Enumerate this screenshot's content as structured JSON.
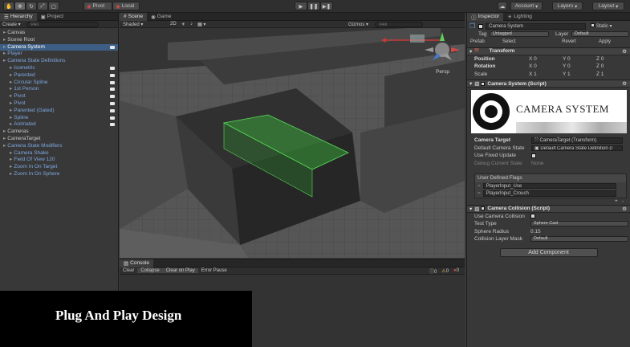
{
  "toolbar": {
    "pivot": "Pivot",
    "local": "Local",
    "account": "Account",
    "layers": "Layers",
    "layout": "Layout"
  },
  "hierarchy": {
    "tab_hierarchy": "Hierarchy",
    "tab_project": "Project",
    "create": "Create",
    "search_placeholder": "All",
    "items": [
      {
        "label": "Canvas",
        "indent": 0,
        "style": "normal",
        "cam": false
      },
      {
        "label": "Scene Root",
        "indent": 0,
        "style": "normal",
        "cam": false
      },
      {
        "label": "Camera System",
        "indent": 0,
        "style": "selected",
        "cam": true
      },
      {
        "label": "Player",
        "indent": 0,
        "style": "blue",
        "cam": false
      },
      {
        "label": "Camera State Definitions",
        "indent": 0,
        "style": "blue",
        "cam": false
      },
      {
        "label": "Isometric",
        "indent": 1,
        "style": "blue",
        "cam": true
      },
      {
        "label": "Parented",
        "indent": 1,
        "style": "blue",
        "cam": true
      },
      {
        "label": "Circular Spline",
        "indent": 1,
        "style": "blue",
        "cam": true
      },
      {
        "label": "1st Person",
        "indent": 1,
        "style": "blue",
        "cam": true
      },
      {
        "label": "Pivot",
        "indent": 1,
        "style": "blue",
        "cam": true
      },
      {
        "label": "Pivot",
        "indent": 1,
        "style": "blue",
        "cam": true
      },
      {
        "label": "Parented (Gated)",
        "indent": 1,
        "style": "blue",
        "cam": true
      },
      {
        "label": "Spline",
        "indent": 1,
        "style": "blue",
        "cam": true
      },
      {
        "label": "Animated",
        "indent": 1,
        "style": "blue",
        "cam": true
      },
      {
        "label": "Cameras",
        "indent": 0,
        "style": "normal",
        "cam": false
      },
      {
        "label": "CameraTarget",
        "indent": 0,
        "style": "normal",
        "cam": false
      },
      {
        "label": "Camera State Modifiers",
        "indent": 0,
        "style": "blue",
        "cam": false
      },
      {
        "label": "Camera Shake",
        "indent": 1,
        "style": "blue",
        "cam": false
      },
      {
        "label": "Field Of View 120",
        "indent": 1,
        "style": "blue",
        "cam": false
      },
      {
        "label": "Zoom In On Target",
        "indent": 1,
        "style": "blue",
        "cam": false
      },
      {
        "label": "Zoom In On Sphere",
        "indent": 1,
        "style": "blue",
        "cam": false
      }
    ]
  },
  "scene": {
    "tab_scene": "Scene",
    "tab_game": "Game",
    "shaded": "Shaded",
    "mode_2d": "2D",
    "gizmos": "Gizmos",
    "search_placeholder": "All",
    "persp": "Persp"
  },
  "console": {
    "tab": "Console",
    "clear": "Clear",
    "collapse": "Collapse",
    "clear_on_play": "Clear on Play",
    "error_pause": "Error Pause",
    "count_info": "0",
    "count_warn": "0",
    "count_error": "0"
  },
  "inspector": {
    "tab_inspector": "Inspector",
    "tab_lighting": "Lighting",
    "object_name": "Camera System",
    "static_label": "Static",
    "tag_label": "Tag",
    "tag_value": "Untagged",
    "layer_label": "Layer",
    "layer_value": "Default",
    "prefab_label": "Prefab",
    "prefab_select": "Select",
    "prefab_revert": "Revert",
    "prefab_apply": "Apply",
    "transform": {
      "title": "Transform",
      "position_label": "Position",
      "rotation_label": "Rotation",
      "scale_label": "Scale",
      "pos": [
        "X 0",
        "Y 0",
        "Z 0"
      ],
      "rot": [
        "X 0",
        "Y 0",
        "Z 0"
      ],
      "scl": [
        "X 1",
        "Y 1",
        "Z 1"
      ]
    },
    "camera_system": {
      "title": "Camera System (Script)",
      "banner_text": "CAMERA SYSTEM",
      "camera_target_label": "Camera Target",
      "camera_target_value": "CameraTarget (Transform)",
      "default_state_label": "Default Camera State",
      "default_state_value": "Default Camera State Definition (I",
      "use_fixed_update_label": "Use Fixed Update",
      "debug_state_label": "Debug Current State",
      "debug_state_value": "None"
    },
    "user_flags": {
      "title": "User Defined Flags",
      "items": [
        "PlayerInput_Use",
        "PlayerInput_Crouch"
      ]
    },
    "camera_collision": {
      "title": "Camera Collision (Script)",
      "use_label": "Use Camera Collision",
      "test_type_label": "Test Type",
      "test_type_value": "Sphere Cast",
      "sphere_radius_label": "Sphere Radius",
      "sphere_radius_value": "0.15",
      "layer_mask_label": "Collision Layer Mask",
      "layer_mask_value": "Default"
    },
    "add_component": "Add Component"
  },
  "overlay": {
    "title": "Plug And Play Design"
  },
  "colors": {
    "selection": "#3d5f86",
    "blue_text": "#7ea7e0",
    "green_volume": "#3cbc3c"
  }
}
